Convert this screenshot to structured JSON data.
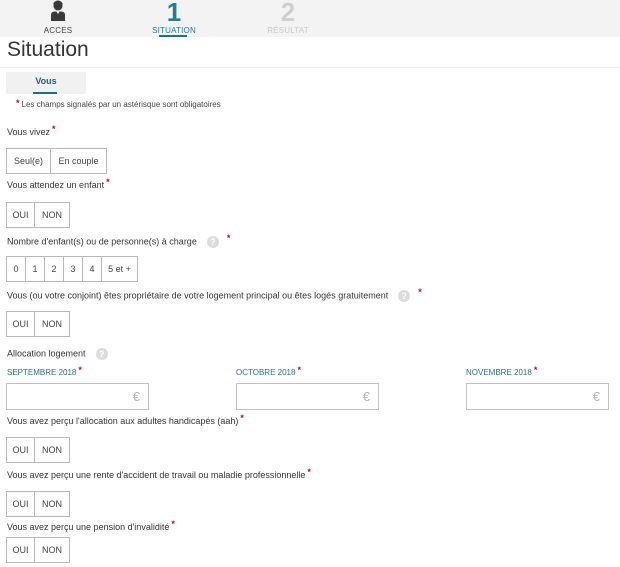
{
  "stepper": {
    "steps": [
      {
        "label": "ACCES",
        "icon": "user-icon"
      },
      {
        "number": "1",
        "label": "SITUATION",
        "active": true
      },
      {
        "number": "2",
        "label": "RÉSULTAT"
      }
    ]
  },
  "page": {
    "title": "Situation",
    "tab": "Vous",
    "required_note": "Les champs signalés par un astérisque sont obligatoires",
    "required_marker": "*"
  },
  "questions": {
    "vous_vivez": {
      "label": "Vous vivez",
      "options": [
        "Seul(e)",
        "En couple"
      ]
    },
    "enfant": {
      "label": "Vous attendez un enfant",
      "options": [
        "OUI",
        "NON"
      ]
    },
    "nombre_enfants": {
      "label": "Nombre d'enfant(s) ou de personne(s) à charge",
      "options": [
        "0",
        "1",
        "2",
        "3",
        "4",
        "5 et +"
      ]
    },
    "proprietaire": {
      "label": "Vous (ou votre conjoint) êtes propriétaire de votre logement principal ou êtes logés gratuitement",
      "options": [
        "OUI",
        "NON"
      ]
    },
    "allocation_logement": {
      "label": "Allocation logement",
      "months": [
        {
          "label": "SEPTEMBRE 2018",
          "value": "",
          "currency": "€"
        },
        {
          "label": "OCTOBRE 2018",
          "value": "",
          "currency": "€"
        },
        {
          "label": "NOVEMBRE 2018",
          "value": "",
          "currency": "€"
        }
      ]
    },
    "aah": {
      "label": "Vous avez perçu l'allocation aux adultes handicapés (aah)",
      "options": [
        "OUI",
        "NON"
      ]
    },
    "rente": {
      "label": "Vous avez perçu une rente d'accident de travail ou maladie professionnelle",
      "options": [
        "OUI",
        "NON"
      ]
    },
    "invalidite": {
      "label": "Vous avez perçu une pension d'invalidité",
      "options": [
        "OUI",
        "NON"
      ]
    }
  },
  "help_icon_glyph": "?",
  "colors": {
    "accent": "#1d7f9c",
    "required": "#b0102a",
    "inactive_step": "#cfcfcf"
  }
}
